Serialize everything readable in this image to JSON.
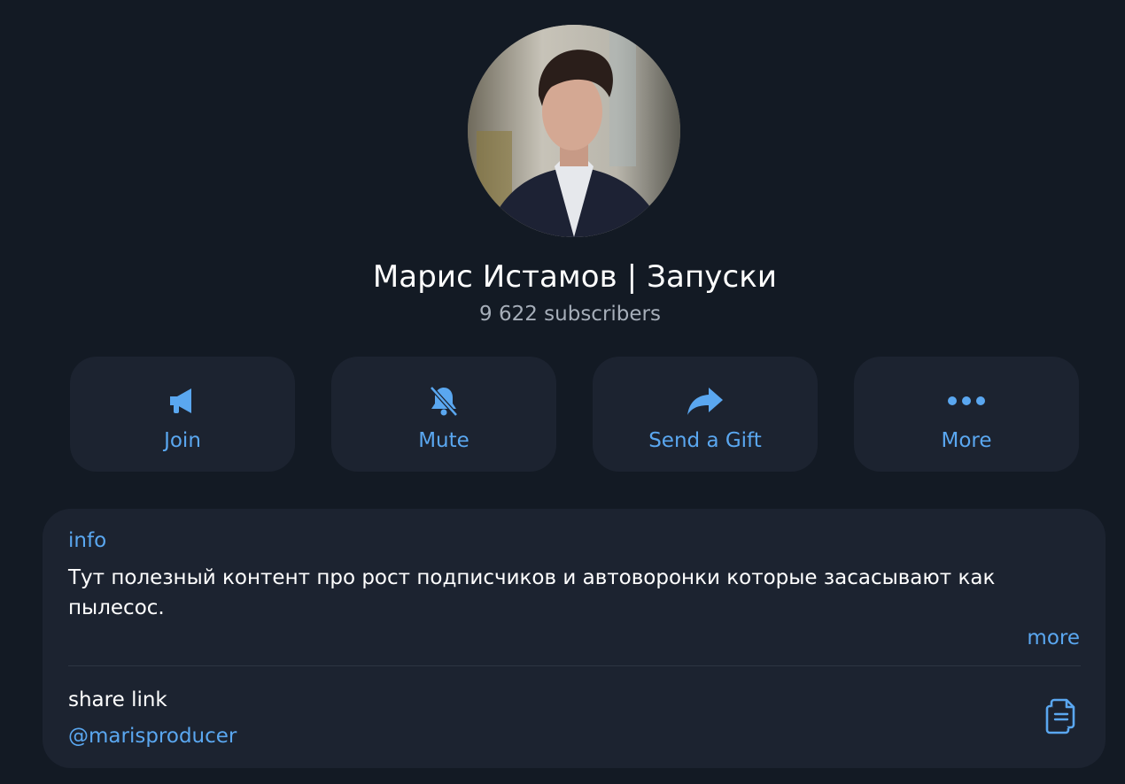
{
  "channel": {
    "title": "Марис Истамов | Запуски",
    "subscribers": "9 622 subscribers"
  },
  "actions": [
    {
      "label": "Join",
      "icon": "megaphone-icon"
    },
    {
      "label": "Mute",
      "icon": "bell-muted-icon"
    },
    {
      "label": "Send a Gift",
      "icon": "share-arrow-icon"
    },
    {
      "label": "More",
      "icon": "more-dots-icon"
    }
  ],
  "info": {
    "heading": "info",
    "text": "Тут полезный контент про рост подписчиков и автоворонки которые засасывают как пылесос.",
    "more_label": "more"
  },
  "share": {
    "heading": "share link",
    "value": "@marisproducer",
    "icon": "copy-icon"
  },
  "colors": {
    "background": "#131a24",
    "card": "#1c2330",
    "accent": "#5aa7f0",
    "text_primary": "#ffffff",
    "text_secondary": "#a6aeb9"
  }
}
